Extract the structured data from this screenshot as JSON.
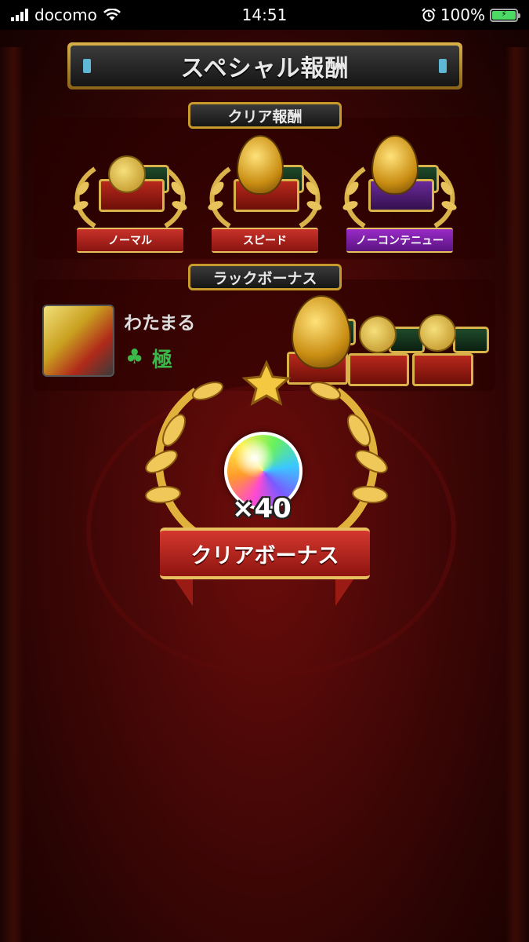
{
  "status_bar": {
    "carrier": "docomo",
    "time": "14:51",
    "battery": "100%"
  },
  "title": "スペシャル報酬",
  "clear_rewards": {
    "label": "クリア報酬",
    "items": [
      {
        "label": "ノーマル",
        "item": "coin-chest",
        "ribbon_color": "#b02822"
      },
      {
        "label": "スピード",
        "item": "golden-egg-chest",
        "ribbon_color": "#b02822"
      },
      {
        "label": "ノーコンテニュー",
        "item": "golden-egg-chest",
        "ribbon_color": "#7a1fa8"
      }
    ]
  },
  "luck_bonus": {
    "label": "ラックボーナス",
    "character_name": "わたまる",
    "luck_rank": "極",
    "rewards": [
      "golden-egg-chest",
      "coin-chest",
      "coin-chest"
    ]
  },
  "clear_bonus": {
    "label": "クリアボーナス",
    "item": "rainbow-orb",
    "count": "×40"
  },
  "colors": {
    "background": "#4a0807",
    "gold": "#d9b24a",
    "luck_green": "#3cb84a"
  }
}
